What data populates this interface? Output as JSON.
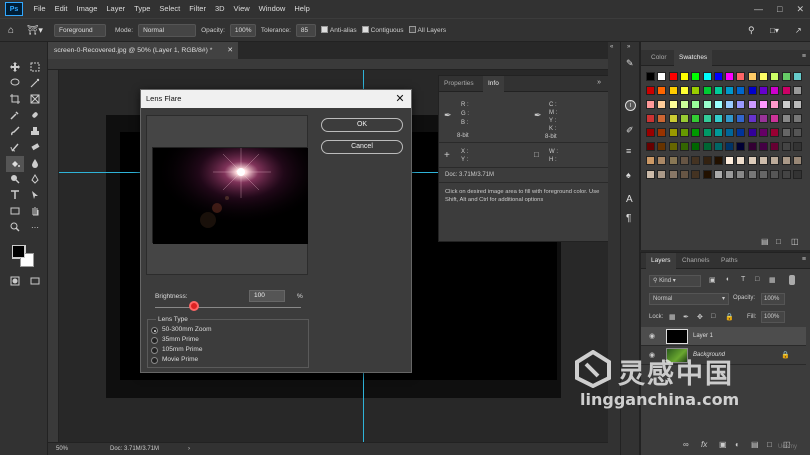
{
  "app": {
    "logo": "Ps"
  },
  "menu": [
    "File",
    "Edit",
    "Image",
    "Layer",
    "Type",
    "Select",
    "Filter",
    "3D",
    "View",
    "Window",
    "Help"
  ],
  "options": {
    "source_value": "Foreground",
    "mode_label": "Mode:",
    "mode_value": "Normal",
    "opacity_label": "Opacity:",
    "opacity_value": "100%",
    "tolerance_label": "Tolerance:",
    "tolerance_value": "85",
    "antialias_label": "Anti-alias",
    "contiguous_label": "Contiguous",
    "all_layers_label": "All Layers"
  },
  "document": {
    "tab_title": "screen-0-Recovered.jpg @ 50% (Layer 1, RGB/8#) *"
  },
  "status": {
    "zoom": "50%",
    "doc": "Doc: 3.71M/3.71M"
  },
  "dialog": {
    "title": "Lens Flare",
    "ok": "OK",
    "cancel": "Cancel",
    "brightness_label": "Brightness:",
    "brightness_value": "100",
    "brightness_unit": "%",
    "brightness_slider_fraction": 0.27,
    "lens_type_label": "Lens Type",
    "lens_types": [
      "50-300mm Zoom",
      "35mm Prime",
      "105mm Prime",
      "Movie Prime"
    ],
    "selected_lens_index": 0
  },
  "info_panel": {
    "tabs": [
      "Properties",
      "Info"
    ],
    "active_tab": "Info",
    "rgb_labels": [
      "R :",
      "G :",
      "B :"
    ],
    "cmyk_labels": [
      "C :",
      "M :",
      "Y :",
      "K :"
    ],
    "bitdepth_left": "8-bit",
    "bitdepth_right": "8-bit",
    "xy_labels": [
      "X :",
      "Y :"
    ],
    "wh_labels": [
      "W :",
      "H :"
    ],
    "doc": "Doc: 3.71M/3.71M",
    "hint": "Click on desired image area to fill with foreground color. Use Shift, Alt and Ctrl for additional options"
  },
  "swatches_panel": {
    "tabs": [
      "Color",
      "Swatches"
    ],
    "active_tab": "Swatches"
  },
  "layers_panel": {
    "tabs": [
      "Layers",
      "Channels",
      "Paths"
    ],
    "kind_label": "Kind",
    "blend_mode": "Normal",
    "opacity_label": "Opacity:",
    "opacity_value": "100%",
    "lock_label": "Lock:",
    "fill_label": "Fill:",
    "fill_value": "100%",
    "layers": [
      {
        "name": "Layer 1"
      },
      {
        "name": "Background"
      }
    ]
  },
  "watermark": {
    "cn_text": "灵感中国",
    "url": "lingganchina.com",
    "brand": "Udemy"
  }
}
